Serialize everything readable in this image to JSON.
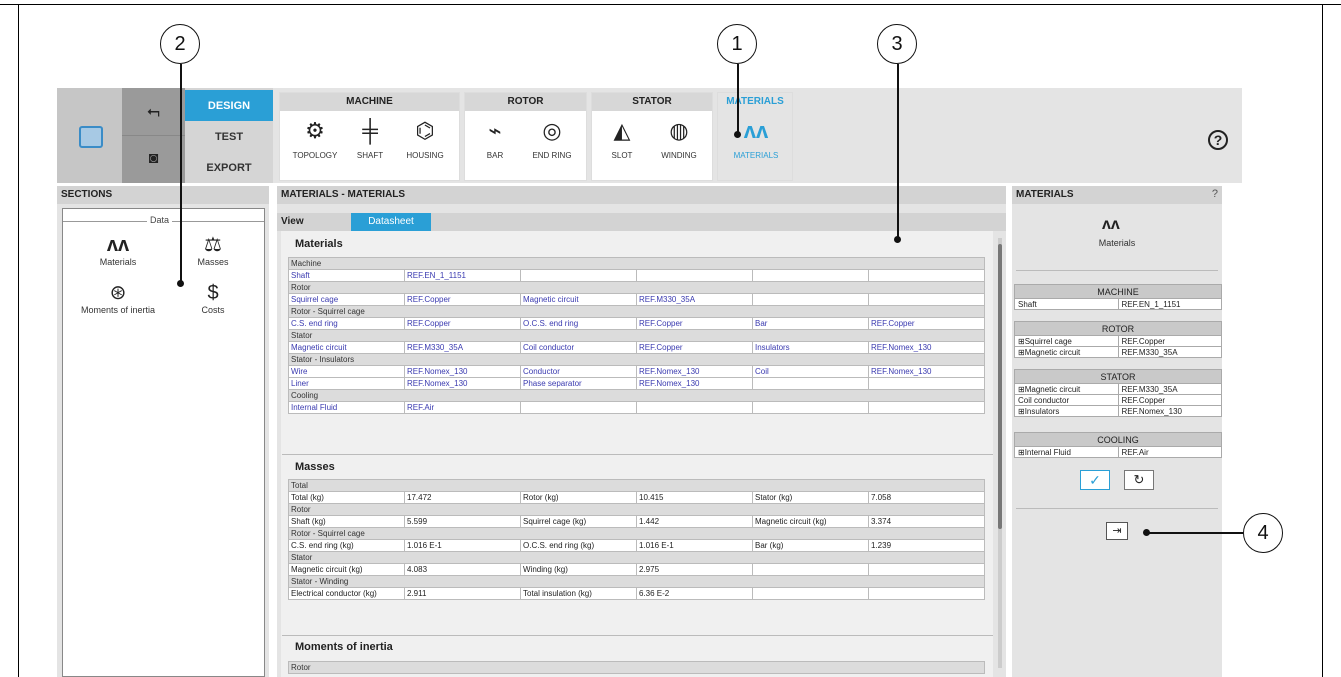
{
  "callouts": {
    "c1": "1",
    "c2": "2",
    "c3": "3",
    "c4": "4"
  },
  "toolbar": {
    "tabs": [
      "DESIGN",
      "TEST",
      "EXPORT"
    ],
    "groups": {
      "machine": {
        "title": "MACHINE",
        "items": [
          "TOPOLOGY",
          "SHAFT",
          "HOUSING"
        ]
      },
      "rotor": {
        "title": "ROTOR",
        "items": [
          "BAR",
          "END RING"
        ]
      },
      "stator": {
        "title": "STATOR",
        "items": [
          "SLOT",
          "WINDING"
        ]
      },
      "materials": {
        "title": "MATERIALS",
        "items": [
          "MATERIALS"
        ]
      }
    },
    "help": "?"
  },
  "sections": {
    "title": "SECTIONS",
    "group": "Data",
    "items": [
      "Materials",
      "Masses",
      "Moments of inertia",
      "Costs"
    ]
  },
  "main": {
    "title": "MATERIALS - MATERIALS",
    "view_label": "View",
    "datasheet_tab": "Datasheet",
    "materials_title": "Materials",
    "masses_title": "Masses",
    "inertia_title": "Moments of inertia",
    "inertia_first_row": "Rotor",
    "materials_rows": [
      {
        "h": "Machine"
      },
      {
        "c": [
          "Shaft",
          "REF.EN_1_1151",
          "",
          "",
          "",
          ""
        ]
      },
      {
        "h": "Rotor"
      },
      {
        "c": [
          "Squirrel cage",
          "REF.Copper",
          "Magnetic circuit",
          "REF.M330_35A",
          "",
          ""
        ]
      },
      {
        "h": "Rotor - Squirrel cage"
      },
      {
        "c": [
          "C.S. end ring",
          "REF.Copper",
          "O.C.S. end ring",
          "REF.Copper",
          "Bar",
          "REF.Copper"
        ]
      },
      {
        "h": "Stator"
      },
      {
        "c": [
          "Magnetic circuit",
          "REF.M330_35A",
          "Coil conductor",
          "REF.Copper",
          "Insulators",
          "REF.Nomex_130"
        ]
      },
      {
        "h": "Stator - Insulators"
      },
      {
        "c": [
          "Wire",
          "REF.Nomex_130",
          "Conductor",
          "REF.Nomex_130",
          "Coil",
          "REF.Nomex_130"
        ]
      },
      {
        "c": [
          "Liner",
          "REF.Nomex_130",
          "Phase separator",
          "REF.Nomex_130",
          "",
          ""
        ]
      },
      {
        "h": "Cooling"
      },
      {
        "c": [
          "Internal Fluid",
          "REF.Air",
          "",
          "",
          "",
          ""
        ]
      }
    ],
    "masses_rows": [
      {
        "h": "Total"
      },
      {
        "c": [
          "Total (kg)",
          "17.472",
          "Rotor (kg)",
          "10.415",
          "Stator (kg)",
          "7.058"
        ]
      },
      {
        "h": "Rotor"
      },
      {
        "c": [
          "Shaft (kg)",
          "5.599",
          "Squirrel cage (kg)",
          "1.442",
          "Magnetic circuit (kg)",
          "3.374"
        ]
      },
      {
        "h": "Rotor - Squirrel cage"
      },
      {
        "c": [
          "C.S. end ring (kg)",
          "1.016 E-1",
          "O.C.S. end ring (kg)",
          "1.016 E-1",
          "Bar (kg)",
          "1.239"
        ]
      },
      {
        "h": "Stator"
      },
      {
        "c": [
          "Magnetic circuit (kg)",
          "4.083",
          "Winding (kg)",
          "2.975",
          "",
          ""
        ]
      },
      {
        "h": "Stator - Winding"
      },
      {
        "c": [
          "Electrical conductor (kg)",
          "2.911",
          "Total insulation (kg)",
          "6.36 E-2",
          "",
          ""
        ]
      }
    ]
  },
  "right": {
    "title": "MATERIALS",
    "help": "?",
    "caption": "Materials",
    "machine": {
      "title": "MACHINE",
      "rows": [
        [
          "Shaft",
          "REF.EN_1_1151"
        ]
      ]
    },
    "rotor": {
      "title": "ROTOR",
      "rows": [
        [
          "⊞Squirrel cage",
          "REF.Copper"
        ],
        [
          "⊞Magnetic circuit",
          "REF.M330_35A"
        ]
      ]
    },
    "stator": {
      "title": "STATOR",
      "rows": [
        [
          "⊞Magnetic circuit",
          "REF.M330_35A"
        ],
        [
          "Coil conductor",
          "REF.Copper"
        ],
        [
          "⊞Insulators",
          "REF.Nomex_130"
        ]
      ]
    },
    "cooling": {
      "title": "COOLING",
      "rows": [
        [
          "⊞Internal Fluid",
          "REF.Air"
        ]
      ]
    }
  }
}
